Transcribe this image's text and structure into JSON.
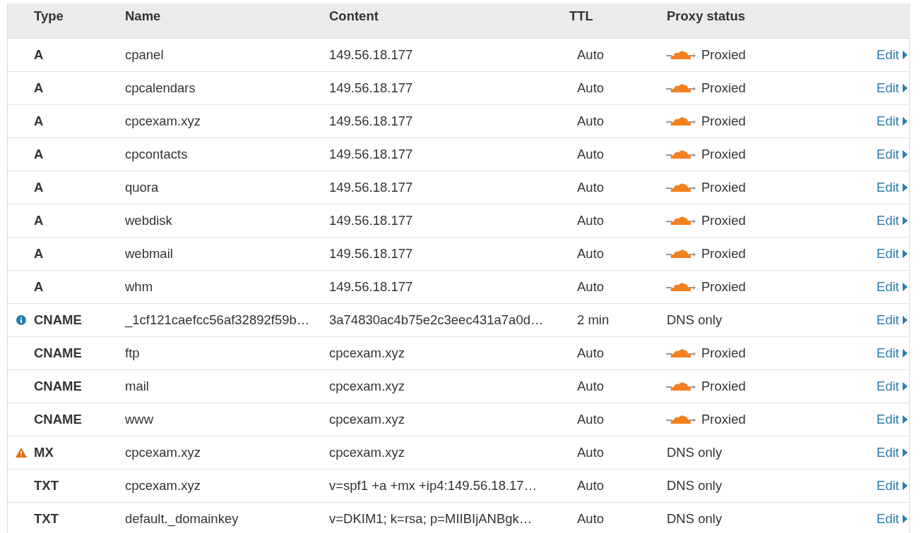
{
  "table": {
    "columns": [
      "Type",
      "Name",
      "Content",
      "TTL",
      "Proxy status"
    ],
    "rows": [
      {
        "kind": "plain",
        "type": "A",
        "name": "cpanel",
        "content": "149.56.18.177",
        "ttl": "Auto",
        "proxied": true,
        "proxy_status": "Proxied",
        "action": "Edit"
      },
      {
        "kind": "plain",
        "type": "A",
        "name": "cpcalendars",
        "content": "149.56.18.177",
        "ttl": "Auto",
        "proxied": true,
        "proxy_status": "Proxied",
        "action": "Edit"
      },
      {
        "kind": "plain",
        "type": "A",
        "name": "cpcexam.xyz",
        "content": "149.56.18.177",
        "ttl": "Auto",
        "proxied": true,
        "proxy_status": "Proxied",
        "action": "Edit"
      },
      {
        "kind": "plain",
        "type": "A",
        "name": "cpcontacts",
        "content": "149.56.18.177",
        "ttl": "Auto",
        "proxied": true,
        "proxy_status": "Proxied",
        "action": "Edit"
      },
      {
        "kind": "plain",
        "type": "A",
        "name": "quora",
        "content": "149.56.18.177",
        "ttl": "Auto",
        "proxied": true,
        "proxy_status": "Proxied",
        "action": "Edit"
      },
      {
        "kind": "plain",
        "type": "A",
        "name": "webdisk",
        "content": "149.56.18.177",
        "ttl": "Auto",
        "proxied": true,
        "proxy_status": "Proxied",
        "action": "Edit"
      },
      {
        "kind": "plain",
        "type": "A",
        "name": "webmail",
        "content": "149.56.18.177",
        "ttl": "Auto",
        "proxied": true,
        "proxy_status": "Proxied",
        "action": "Edit"
      },
      {
        "kind": "plain",
        "type": "A",
        "name": "whm",
        "content": "149.56.18.177",
        "ttl": "Auto",
        "proxied": true,
        "proxy_status": "Proxied",
        "action": "Edit"
      },
      {
        "kind": "info",
        "type": "CNAME",
        "name": "_1cf121caefcc56af32892f59b…",
        "content": "3a74830ac4b75e2c3eec431a7a0d…",
        "ttl": "2 min",
        "proxied": false,
        "proxy_status": "DNS only",
        "action": "Edit"
      },
      {
        "kind": "plain",
        "type": "CNAME",
        "name": "ftp",
        "content": "cpcexam.xyz",
        "ttl": "Auto",
        "proxied": true,
        "proxy_status": "Proxied",
        "action": "Edit"
      },
      {
        "kind": "plain",
        "type": "CNAME",
        "name": "mail",
        "content": "cpcexam.xyz",
        "ttl": "Auto",
        "proxied": true,
        "proxy_status": "Proxied",
        "action": "Edit"
      },
      {
        "kind": "plain",
        "type": "CNAME",
        "name": "www",
        "content": "cpcexam.xyz",
        "ttl": "Auto",
        "proxied": true,
        "proxy_status": "Proxied",
        "action": "Edit"
      },
      {
        "kind": "warning",
        "type": "MX",
        "name": "cpcexam.xyz",
        "content": "cpcexam.xyz",
        "ttl": "Auto",
        "proxied": false,
        "proxy_status": "DNS only",
        "action": "Edit"
      },
      {
        "kind": "plain",
        "type": "TXT",
        "name": "cpcexam.xyz",
        "content": "v=spf1 +a +mx +ip4:149.56.18.17…",
        "ttl": "Auto",
        "proxied": false,
        "proxy_status": "DNS only",
        "action": "Edit"
      },
      {
        "kind": "plain",
        "type": "TXT",
        "name": "default._domainkey",
        "content": "v=DKIM1; k=rsa; p=MIIBIjANBgk…",
        "ttl": "Auto",
        "proxied": false,
        "proxy_status": "DNS only",
        "action": "Edit"
      }
    ]
  }
}
